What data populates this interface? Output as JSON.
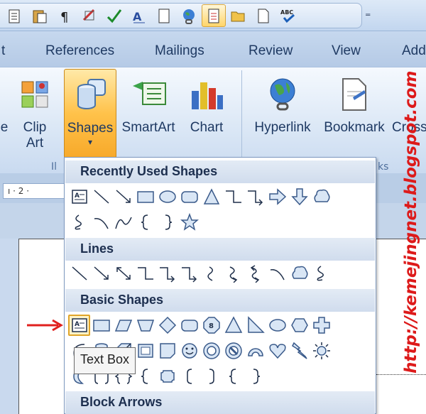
{
  "quick_access": {
    "icons": [
      "bullets-list-icon",
      "paste-icon",
      "pilcrow-icon",
      "hide-icon",
      "spelling-icon",
      "font-size-icon",
      "page-icon",
      "hyperlink-globe-icon",
      "document-icon",
      "open-folder-icon",
      "new-document-icon",
      "abc-spelling-icon"
    ],
    "active_index": 8,
    "more_symbol": "⁼"
  },
  "tabs": [
    "t",
    "References",
    "Mailings",
    "Review",
    "View",
    "Add"
  ],
  "ribbon": {
    "buttons": [
      {
        "id": "partial",
        "label_top": "e",
        "label_bottom": ""
      },
      {
        "id": "clip-art",
        "label_top": "Clip",
        "label_bottom": "Art"
      },
      {
        "id": "shapes",
        "label_top": "Shapes",
        "label_bottom": "▾"
      },
      {
        "id": "smartart",
        "label_top": "SmartArt",
        "label_bottom": ""
      },
      {
        "id": "chart",
        "label_top": "Chart",
        "label_bottom": ""
      },
      {
        "id": "hyperlink",
        "label_top": "Hyperlink",
        "label_bottom": ""
      },
      {
        "id": "bookmark",
        "label_top": "Bookmark",
        "label_bottom": ""
      },
      {
        "id": "cross",
        "label_top": "Cross",
        "label_bottom": ""
      }
    ],
    "group_labels": [
      "Il",
      "ks"
    ]
  },
  "ruler": {
    "text": "ı · 2 ·"
  },
  "gallery": {
    "sections": [
      {
        "title": "Recently Used Shapes"
      },
      {
        "title": "Lines"
      },
      {
        "title": "Basic Shapes"
      },
      {
        "title": "Block Arrows"
      }
    ]
  },
  "tooltip": "Text Box",
  "watermark": "http://kemejingnet.blogspot.com",
  "colors": {
    "accent": "#ffc24a",
    "watermark": "#dd1a1a",
    "arrow": "#e0201e"
  }
}
